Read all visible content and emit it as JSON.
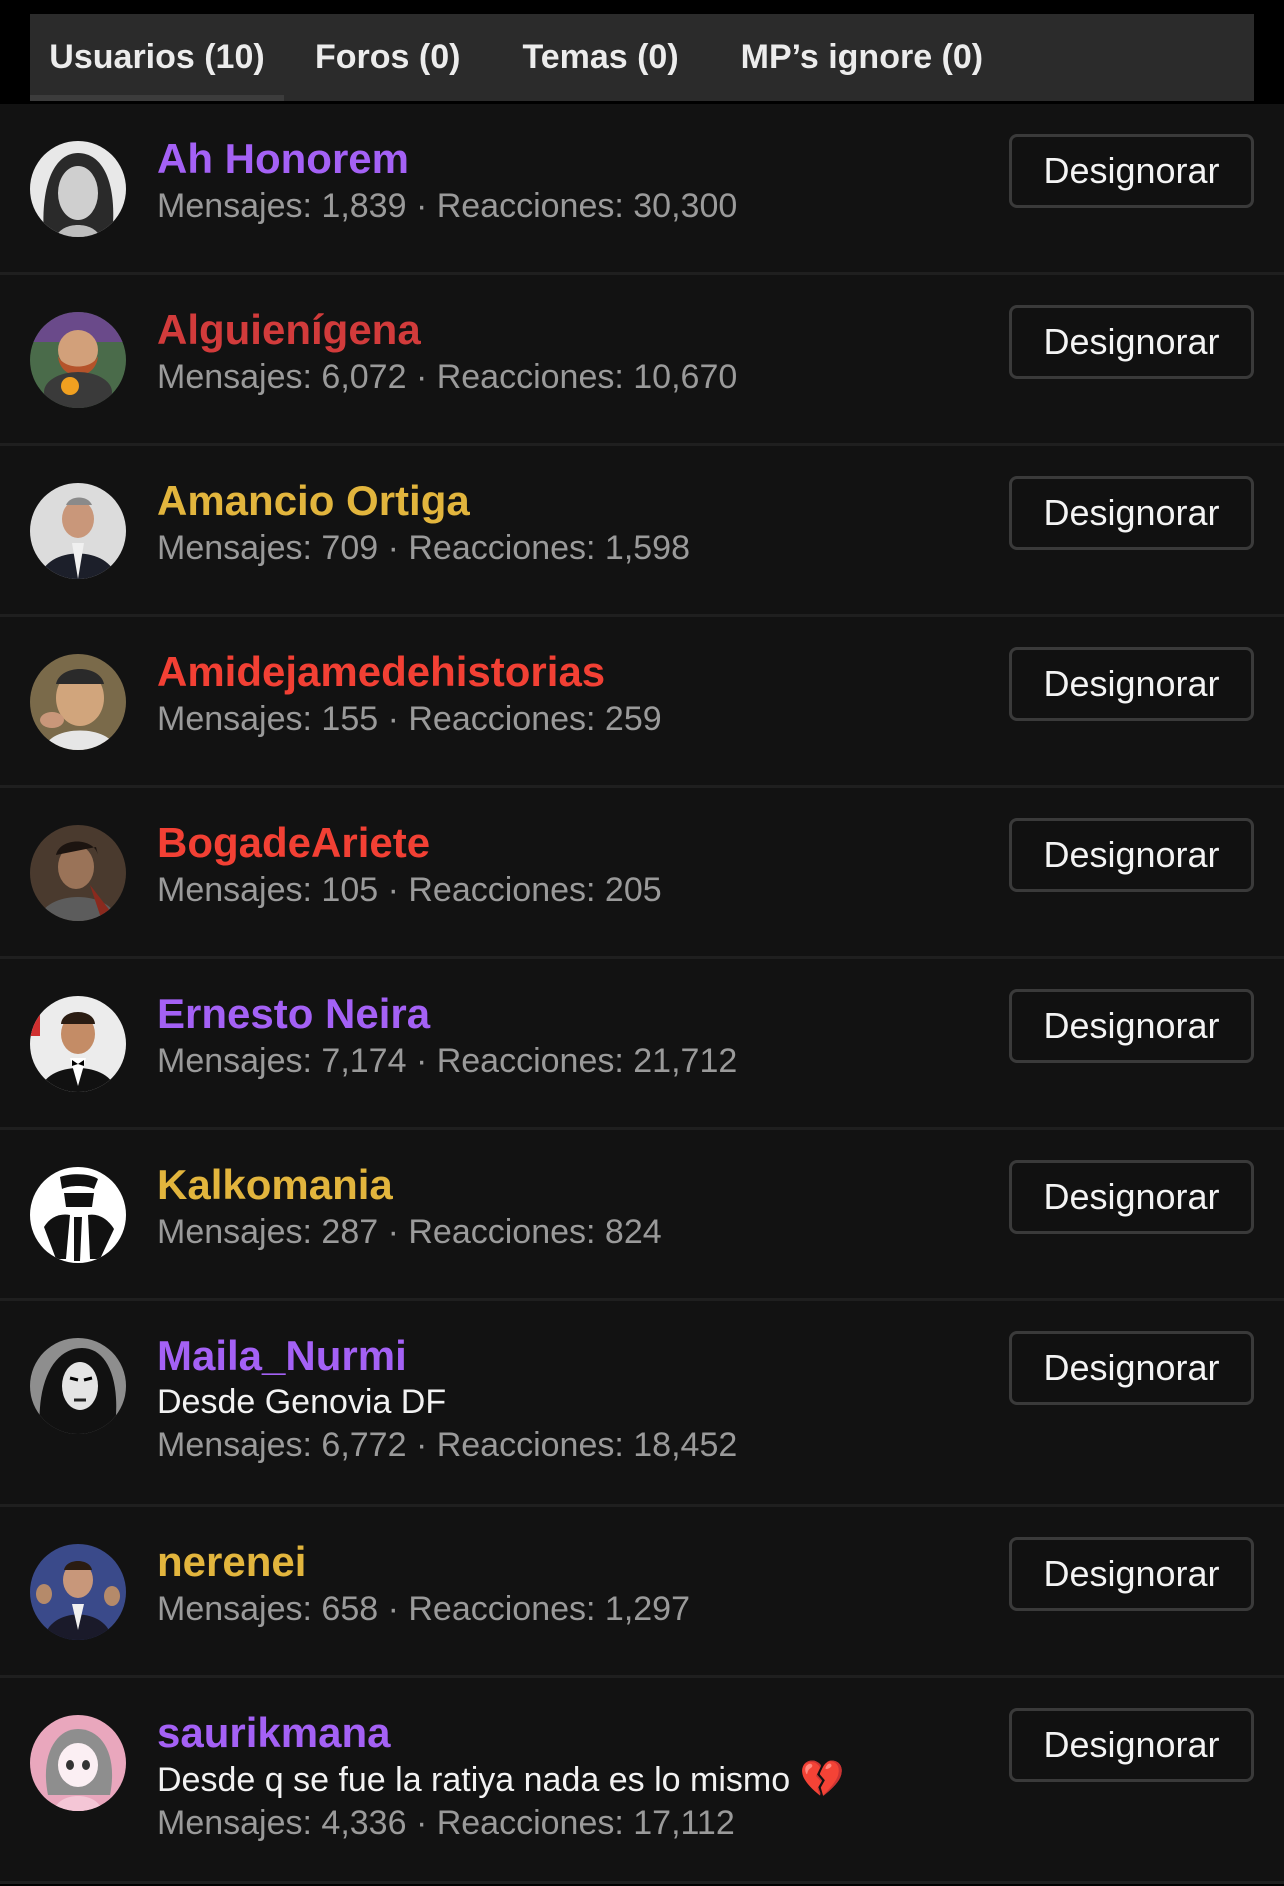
{
  "tabs": [
    {
      "label": "Usuarios (10)",
      "active": true
    },
    {
      "label": "Foros (0)",
      "active": false
    },
    {
      "label": "Temas (0)",
      "active": false
    },
    {
      "label": "MP’s ignore (0)",
      "active": false
    }
  ],
  "stats_separator": " · ",
  "users": [
    {
      "name": "Ah Honorem",
      "color": "#a461f5",
      "tagline": "",
      "messages": "Mensajes: 1,839",
      "reactions": "Reacciones: 30,300",
      "button": "Designorar",
      "avatar": "woman-portrait-avatar"
    },
    {
      "name": "Alguienígena",
      "color": "#d23b3b",
      "tagline": "",
      "messages": "Mensajes: 6,072",
      "reactions": "Reacciones: 10,670",
      "button": "Designorar",
      "avatar": "bearded-man-avatar"
    },
    {
      "name": "Amancio Ortiga",
      "color": "#e2b53d",
      "tagline": "",
      "messages": "Mensajes: 709",
      "reactions": "Reacciones: 1,598",
      "button": "Designorar",
      "avatar": "suited-man-avatar"
    },
    {
      "name": "Amidejamedehistorias",
      "color": "#f24034",
      "tagline": "",
      "messages": "Mensajes: 155",
      "reactions": "Reacciones: 259",
      "button": "Designorar",
      "avatar": "older-man-avatar"
    },
    {
      "name": "BogadeAriete",
      "color": "#f24034",
      "tagline": "",
      "messages": "Mensajes: 105",
      "reactions": "Reacciones: 205",
      "button": "Designorar",
      "avatar": "warrior-avatar"
    },
    {
      "name": "Ernesto Neira",
      "color": "#a461f5",
      "tagline": "",
      "messages": "Mensajes: 7,174",
      "reactions": "Reacciones: 21,712",
      "button": "Designorar",
      "avatar": "tuxedo-man-avatar"
    },
    {
      "name": "Kalkomania",
      "color": "#e2b53d",
      "tagline": "",
      "messages": "Mensajes: 287",
      "reactions": "Reacciones: 824",
      "button": "Designorar",
      "avatar": "dakar-logo-avatar"
    },
    {
      "name": "Maila_Nurmi",
      "color": "#a461f5",
      "tagline": "Desde Genovia DF",
      "messages": "Mensajes: 6,772",
      "reactions": "Reacciones: 18,452",
      "button": "Designorar",
      "avatar": "vampira-avatar"
    },
    {
      "name": "nerenei",
      "color": "#e2b53d",
      "tagline": "",
      "messages": "Mensajes: 658",
      "reactions": "Reacciones: 1,297",
      "button": "Designorar",
      "avatar": "politician-avatar"
    },
    {
      "name": "saurikmana",
      "color": "#a461f5",
      "tagline": "Desde q se fue la ratiya nada es lo mismo",
      "tagline_emoji": "💔",
      "messages": "Mensajes: 4,336",
      "reactions": "Reacciones: 17,112",
      "button": "Designorar",
      "avatar": "anime-girl-avatar"
    }
  ]
}
